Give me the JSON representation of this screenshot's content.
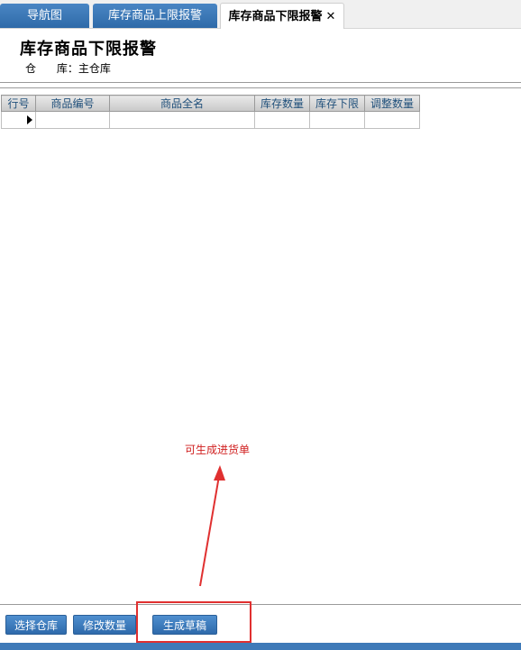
{
  "tabs": [
    {
      "label": "导航图"
    },
    {
      "label": "库存商品上限报警"
    },
    {
      "label": "库存商品下限报警",
      "close": "✕"
    }
  ],
  "page": {
    "title": "库存商品下限报警",
    "warehouse_label": "仓      库：",
    "warehouse_value": "主仓库"
  },
  "grid": {
    "columns": [
      "行号",
      "商品编号",
      "商品全名",
      "库存数量",
      "库存下限",
      "调整数量"
    ],
    "rows": [
      [
        "",
        "",
        "",
        "",
        "",
        ""
      ]
    ]
  },
  "annotation": {
    "text": "可生成进货单",
    "color": "#d02020"
  },
  "buttons": {
    "select_warehouse": "选择仓库",
    "modify_quantity": "修改数量",
    "generate_draft": "生成草稿"
  },
  "colors": {
    "accent": "#2e6aab",
    "annotation": "#e03030"
  }
}
